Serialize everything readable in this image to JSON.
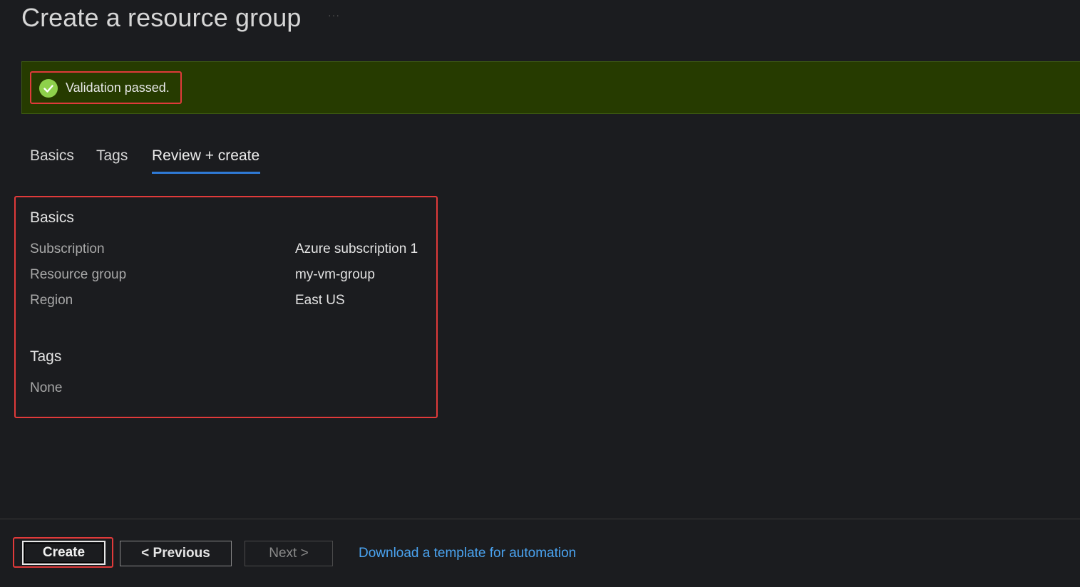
{
  "header": {
    "title": "Create a resource group",
    "more_label": "···"
  },
  "validation": {
    "message": "Validation passed.",
    "status_color": "#8ed14b",
    "icon": "check-circle-icon"
  },
  "tabs": [
    {
      "label": "Basics"
    },
    {
      "label": "Tags"
    },
    {
      "label": "Review + create",
      "active": true
    }
  ],
  "review": {
    "basics_title": "Basics",
    "rows": [
      {
        "label": "Subscription",
        "value": "Azure subscription 1"
      },
      {
        "label": "Resource group",
        "value": "my-vm-group"
      },
      {
        "label": "Region",
        "value": "East US"
      }
    ],
    "tags_title": "Tags",
    "tags_value": "None"
  },
  "footer": {
    "create_label": "Create",
    "previous_label": "< Previous",
    "next_label": "Next >",
    "download_link": "Download a template for automation"
  },
  "colors": {
    "accent": "#2f7ad6",
    "link": "#4aa3f0",
    "highlight": "#e03a3a",
    "banner": "#263b00"
  }
}
